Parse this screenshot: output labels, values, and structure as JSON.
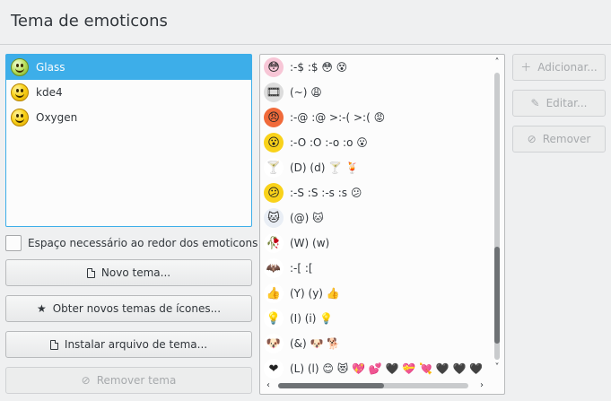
{
  "header": {
    "title": "Tema de emoticons"
  },
  "themes": {
    "items": [
      {
        "label": "Glass",
        "selected": true
      },
      {
        "label": "kde4",
        "selected": false
      },
      {
        "label": "Oxygen",
        "selected": false
      }
    ]
  },
  "options": {
    "spacing_label": "Espaço necessário ao redor dos emoticons",
    "spacing_checked": false
  },
  "left_buttons": {
    "new_theme": "Novo tema...",
    "get_new": "Obter novos temas de ícones...",
    "install_file": "Instalar arquivo de tema...",
    "remove_theme": "Remover tema"
  },
  "right_buttons": {
    "add": "Adicionar...",
    "edit": "Editar...",
    "remove": "Remover"
  },
  "emoticons": [
    {
      "text": ":-$ :$ 😳 😵",
      "icon": "embarrassed-face-icon",
      "glyph": "😳",
      "color": "#f7c6d6"
    },
    {
      "text": "(~) 😩",
      "icon": "film-strip-icon",
      "glyph": "🎞",
      "color": "#dcdcdc"
    },
    {
      "text": ":-@ :@ >:-( >:( 😡",
      "icon": "angry-face-icon",
      "glyph": "😠",
      "color": "#f06a3a"
    },
    {
      "text": ":-O :O :-o :o 😮",
      "icon": "surprised-face-icon",
      "glyph": "😮",
      "color": "#f9d21a"
    },
    {
      "text": "(D) (d) 🍸 🍹",
      "icon": "cocktail-icon",
      "glyph": "🍸",
      "color": "#ffffff"
    },
    {
      "text": ":-S :S :-s :s 😕",
      "icon": "confused-face-icon",
      "glyph": "😕",
      "color": "#f9d21a"
    },
    {
      "text": "(@) 🐱",
      "icon": "cat-face-icon",
      "glyph": "🐱",
      "color": "#e9eef5"
    },
    {
      "text": "(W) (w)",
      "icon": "wilted-rose-icon",
      "glyph": "🥀",
      "color": "#ffffff"
    },
    {
      "text": ":-[ :[",
      "icon": "bat-icon",
      "glyph": "🦇",
      "color": "#ffffff"
    },
    {
      "text": "(Y) (y) 👍",
      "icon": "thumbs-up-icon",
      "glyph": "👍",
      "color": "#ffffff"
    },
    {
      "text": "(I) (i) 💡",
      "icon": "light-bulb-icon",
      "glyph": "💡",
      "color": "#ffffff"
    },
    {
      "text": "(&) 🐶 🐕",
      "icon": "dog-face-icon",
      "glyph": "🐶",
      "color": "#ffffff"
    },
    {
      "text": "(L) (l) 😊 😻 💖 💕 🖤 💝 💘 🖤 🖤 🖤",
      "icon": "red-heart-icon",
      "glyph": "❤",
      "color": "#ffffff"
    }
  ],
  "scrollbars": {
    "up_arrow": "˄",
    "down_arrow": "˅",
    "left_arrow": "‹",
    "right_arrow": "›"
  }
}
